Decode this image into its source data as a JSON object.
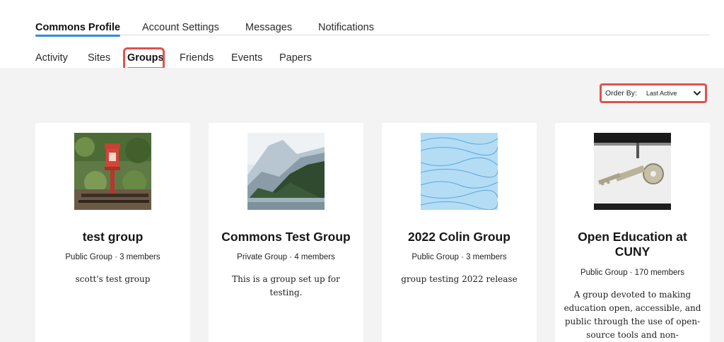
{
  "primary_nav": {
    "tabs": [
      {
        "label": "Commons Profile",
        "active": true
      },
      {
        "label": "Account Settings",
        "active": false
      },
      {
        "label": "Messages",
        "active": false
      },
      {
        "label": "Notifications",
        "active": false
      }
    ]
  },
  "secondary_nav": {
    "tabs": [
      {
        "label": "Activity",
        "active": false
      },
      {
        "label": "Sites",
        "active": false
      },
      {
        "label": "Groups",
        "active": true
      },
      {
        "label": "Friends",
        "active": false
      },
      {
        "label": "Events",
        "active": false
      },
      {
        "label": "Papers",
        "active": false
      }
    ]
  },
  "order_by": {
    "label": "Order By:",
    "selected": "Last Active"
  },
  "groups": [
    {
      "name": "test group",
      "meta": "Public Group · 3 members",
      "description": "scott's test group",
      "image": "red-lantern-garden"
    },
    {
      "name": "Commons Test Group",
      "meta": "Private Group · 4 members",
      "description": "This is a group set up for testing.",
      "image": "mountain-lake"
    },
    {
      "name": "2022 Colin Group",
      "meta": "Public Group · 3 members",
      "description": "group testing 2022 release",
      "image": "blue-wave-pattern"
    },
    {
      "name": "Open Education at CUNY",
      "meta": "Public Group · 170 members",
      "description": "A group devoted to making education open, accessible, and public through the use of open-source tools and non-proprietary",
      "image": "keys-on-hook"
    }
  ],
  "colors": {
    "accent_underline": "#2c8fd6",
    "highlight_border": "#e0524a",
    "content_bg": "#f3f3f3"
  }
}
